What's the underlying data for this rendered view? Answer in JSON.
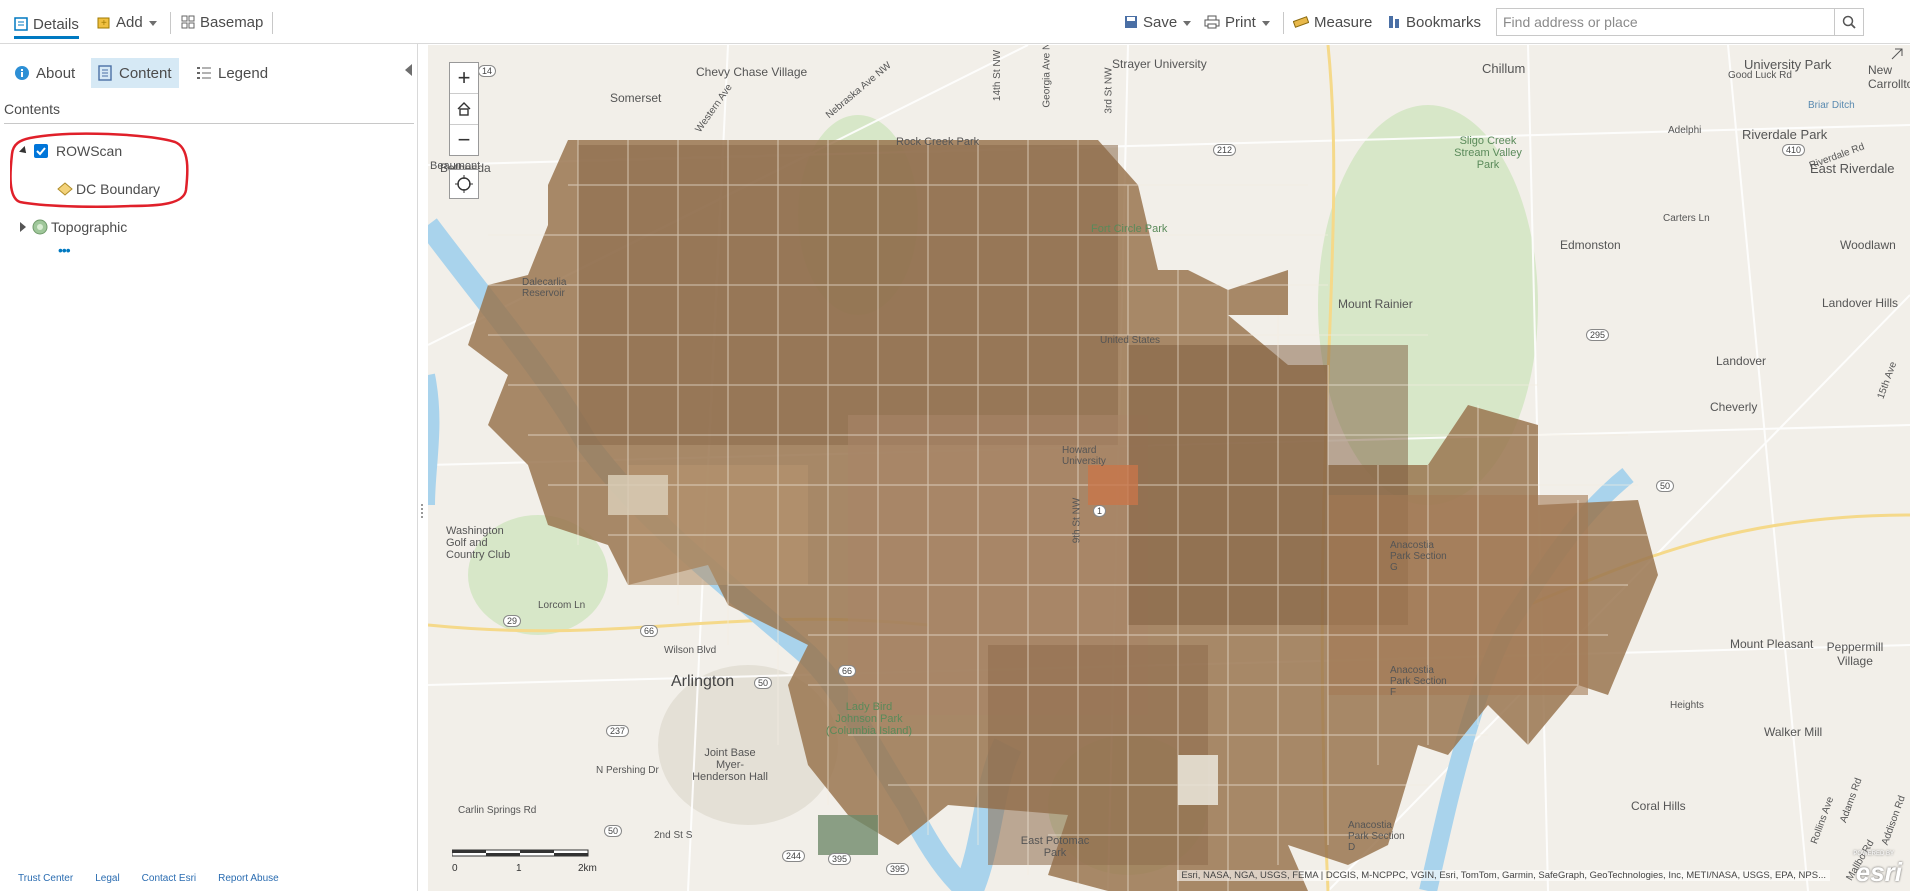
{
  "toolbar": {
    "details_label": "Details",
    "add_label": "Add",
    "basemap_label": "Basemap",
    "save_label": "Save",
    "print_label": "Print",
    "measure_label": "Measure",
    "bookmarks_label": "Bookmarks",
    "search_placeholder": "Find address or place"
  },
  "panel": {
    "tabs": [
      {
        "label": "About",
        "icon": "info-icon"
      },
      {
        "label": "Content",
        "icon": "content-list-icon",
        "active": true
      },
      {
        "label": "Legend",
        "icon": "legend-icon"
      }
    ],
    "contents_header": "Contents",
    "layers": [
      {
        "name": "ROWScan",
        "checked": true,
        "expanded": true
      },
      {
        "name": "DC Boundary",
        "icon": "polygon-layer-icon"
      },
      {
        "name": "Topographic",
        "icon": "basemap-globe-icon",
        "expanded": false
      }
    ],
    "footer_links": [
      "Trust Center",
      "Legal",
      "Contact Esri",
      "Report Abuse"
    ]
  },
  "map": {
    "labels": [
      "Chevy Chase Village",
      "Somerset",
      "Strayer University",
      "Chillum",
      "University Park",
      "Riverdale Park",
      "East Riverdale",
      "Sligo Creek Stream Valley Park",
      "Rock Creek Park",
      "Edmonston",
      "Woodlawn",
      "Landover Hills",
      "Landover",
      "Cheverly",
      "Washington Golf and Country Club",
      "Arlington",
      "Lady Bird Johnson Park (Columbia Island)",
      "Joint Base Myer-Henderson Hall",
      "East Potomac Park",
      "Coral Hills",
      "Walker Mill",
      "Peppermill Village",
      "Mount Rainier",
      "Bethesda",
      "New Carrollton",
      "Good Luck Rd",
      "Carters Ln",
      "Wilson Blvd",
      "Lorcom Ln",
      "N Pershing Dr",
      "Carlin Springs Rd",
      "2nd St S",
      "Western Ave",
      "Nebraska Ave NW",
      "14th St NW",
      "Georgia Ave NW",
      "3rd St NW",
      "Riverdale Rd",
      "Briar Ditch",
      "Adelphi",
      "Beaumont",
      "Dalecarlia Reservoir",
      "Fort Circle Park",
      "Anacostia Park Section G",
      "Anacostia Park Section F",
      "Anacostia Park Section D",
      "Mount Pleasant",
      "Howard University",
      "United States",
      "9th St NW",
      "15th Ave",
      "Adams Rd",
      "Mallbo Rd",
      "Addison Rd",
      "Rollins Ave",
      "Heights"
    ],
    "shields": [
      "14",
      "212",
      "410",
      "295",
      "50",
      "1",
      "29",
      "66",
      "50",
      "66",
      "237",
      "50",
      "244",
      "395",
      "395"
    ],
    "scale_labels": [
      "0",
      "1",
      "2km"
    ],
    "attribution": "Esri, NASA, NGA, USGS, FEMA | DCGIS, M-NCPPC, VGIN, Esri, TomTom, Garmin, SafeGraph, GeoTechnologies, Inc, METI/NASA, USGS, EPA, NPS...",
    "esri_text": "esri",
    "powered_text": "POWERED BY"
  },
  "colors": {
    "accent": "#0079c1",
    "annotation": "#e0202a",
    "water": "#a9d3ec",
    "park": "#cfe3c2"
  }
}
